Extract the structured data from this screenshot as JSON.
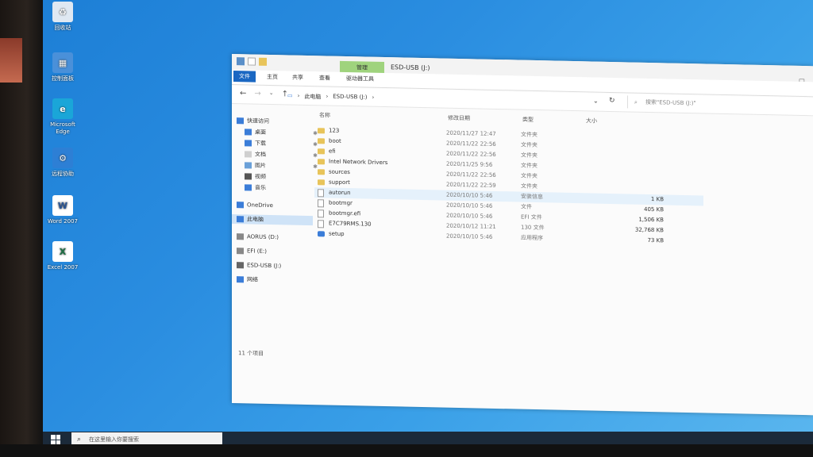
{
  "desktop": {
    "icons": [
      {
        "label": "回收站",
        "color": "#dfe8f2",
        "glyph": "♻"
      },
      {
        "label": "控制面板",
        "color": "#4a90d9",
        "glyph": "▦"
      },
      {
        "label": "Microsoft Edge",
        "color": "#1aa6d8",
        "glyph": "e"
      },
      {
        "label": "远程协助",
        "color": "#2d7fd5",
        "glyph": "⚙"
      },
      {
        "label": "Word 2007",
        "color": "#ffffff",
        "glyph": "W"
      },
      {
        "label": "Excel 2007",
        "color": "#ffffff",
        "glyph": "X"
      }
    ]
  },
  "taskbar": {
    "search_placeholder": "在这里输入你要搜索"
  },
  "window": {
    "title": "ESD-USB (J:)",
    "manage_tab": "管理",
    "tool_tab": "驱动器工具",
    "tabs": [
      "文件",
      "主页",
      "共享",
      "查看"
    ],
    "breadcrumb": [
      "此电脑",
      "ESD-USB (J:)"
    ],
    "search_placeholder": "搜索\"ESD-USB (J:)\"",
    "status": "11 个项目"
  },
  "nav": [
    {
      "label": "快速访问",
      "icon": "star-icon",
      "pinned": false
    },
    {
      "label": "桌面",
      "icon": "desktop-icon",
      "pinned": true
    },
    {
      "label": "下载",
      "icon": "download-icon",
      "pinned": true
    },
    {
      "label": "文档",
      "icon": "document-icon",
      "pinned": true
    },
    {
      "label": "图片",
      "icon": "picture-icon",
      "pinned": true
    },
    {
      "label": "视频",
      "icon": "video-icon",
      "pinned": false
    },
    {
      "label": "音乐",
      "icon": "music-icon",
      "pinned": false
    },
    {
      "label": "OneDrive",
      "icon": "cloud-icon",
      "pinned": false
    },
    {
      "label": "此电脑",
      "icon": "computer-icon",
      "pinned": false,
      "selected": true
    },
    {
      "label": "AORUS (D:)",
      "icon": "drive-icon",
      "pinned": false
    },
    {
      "label": "EFI (E:)",
      "icon": "drive-icon",
      "pinned": false
    },
    {
      "label": "ESD-USB (J:)",
      "icon": "usb-drive-icon",
      "pinned": false
    },
    {
      "label": "网络",
      "icon": "network-icon",
      "pinned": false
    }
  ],
  "columns": {
    "name": "名称",
    "date": "修改日期",
    "type": "类型",
    "size": "大小"
  },
  "files": [
    {
      "name": "123",
      "date": "2020/11/27 12:47",
      "type": "文件夹",
      "size": "",
      "kind": "folder"
    },
    {
      "name": "boot",
      "date": "2020/11/22 22:56",
      "type": "文件夹",
      "size": "",
      "kind": "folder"
    },
    {
      "name": "efi",
      "date": "2020/11/22 22:56",
      "type": "文件夹",
      "size": "",
      "kind": "folder"
    },
    {
      "name": "Intel Network Drivers",
      "date": "2020/11/25 9:56",
      "type": "文件夹",
      "size": "",
      "kind": "folder"
    },
    {
      "name": "sources",
      "date": "2020/11/22 22:56",
      "type": "文件夹",
      "size": "",
      "kind": "folder"
    },
    {
      "name": "support",
      "date": "2020/11/22 22:59",
      "type": "文件夹",
      "size": "",
      "kind": "folder"
    },
    {
      "name": "autorun",
      "date": "2020/10/10 5:46",
      "type": "安装信息",
      "size": "1 KB",
      "kind": "file"
    },
    {
      "name": "bootmgr",
      "date": "2020/10/10 5:46",
      "type": "文件",
      "size": "405 KB",
      "kind": "file"
    },
    {
      "name": "bootmgr.efi",
      "date": "2020/10/10 5:46",
      "type": "EFI 文件",
      "size": "1,506 KB",
      "kind": "file"
    },
    {
      "name": "E7C79RMS.130",
      "date": "2020/10/12 11:21",
      "type": "130 文件",
      "size": "32,768 KB",
      "kind": "file"
    },
    {
      "name": "setup",
      "date": "2020/10/10 5:46",
      "type": "应用程序",
      "size": "73 KB",
      "kind": "setup"
    }
  ]
}
